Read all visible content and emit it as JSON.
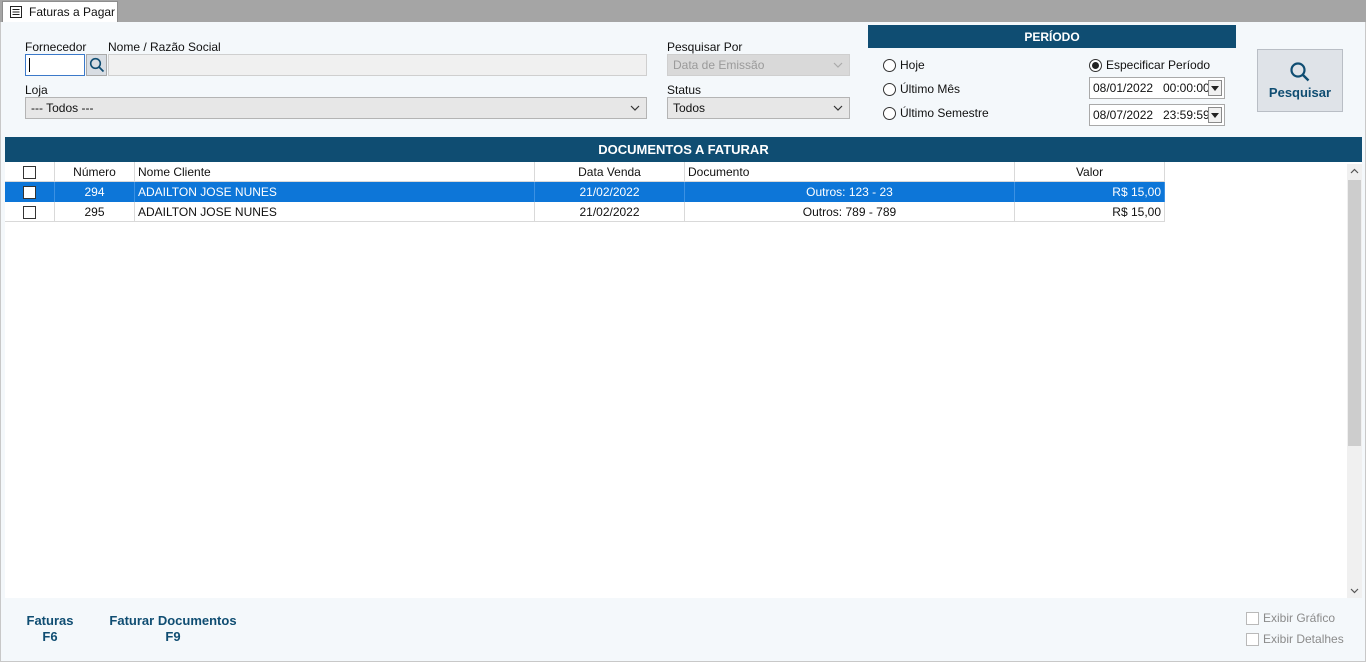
{
  "tab": {
    "title": "Faturas a Pagar",
    "icon": "document-list-icon"
  },
  "filters": {
    "fornecedor_label": "Fornecedor",
    "fornecedor_value": "",
    "nome_label": "Nome / Razão Social",
    "nome_value": "",
    "loja_label": "Loja",
    "loja_value": "--- Todos ---",
    "pesquisar_por_label": "Pesquisar Por",
    "pesquisar_por_value": "Data de Emissão",
    "status_label": "Status",
    "status_value": "Todos"
  },
  "periodo": {
    "title": "PERÍODO",
    "options": [
      {
        "label": "Hoje",
        "selected": false
      },
      {
        "label": "Último Mês",
        "selected": false
      },
      {
        "label": "Último Semestre",
        "selected": false
      },
      {
        "label": "Especificar Período",
        "selected": true
      }
    ],
    "start_date": "08/01/2022",
    "start_time": "00:00:00",
    "end_date": "08/07/2022",
    "end_time": "23:59:59"
  },
  "pesquisar_button": "Pesquisar",
  "documents": {
    "title": "DOCUMENTOS A FATURAR",
    "columns": [
      "Número",
      "Nome Cliente",
      "Data Venda",
      "Documento",
      "Valor"
    ],
    "rows": [
      {
        "numero": "294",
        "cliente": "ADAILTON JOSE NUNES",
        "data": "21/02/2022",
        "documento": "Outros: 123 - 23",
        "valor": "R$ 15,00",
        "selected": true
      },
      {
        "numero": "295",
        "cliente": "ADAILTON JOSE NUNES",
        "data": "21/02/2022",
        "documento": "Outros: 789 - 789",
        "valor": "R$ 15,00",
        "selected": false
      }
    ]
  },
  "footer": {
    "faturas_label": "Faturas",
    "faturas_key": "F6",
    "faturar_label": "Faturar Documentos",
    "faturar_key": "F9",
    "exibir_grafico": "Exibir Gráfico",
    "exibir_detalhes": "Exibir Detalhes"
  },
  "colors": {
    "header_blue": "#0f4d72",
    "selection_blue": "#0d76d8"
  }
}
